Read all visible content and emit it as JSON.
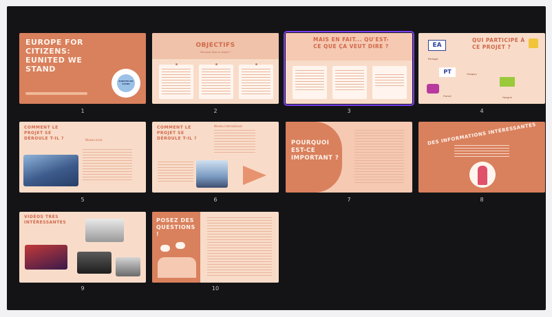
{
  "colors": {
    "frame": "#141417",
    "slide_light": "#f8dcc9",
    "slide_mid": "#f5c9b2",
    "accent": "#d9805d",
    "selected": "#7b3ff2"
  },
  "slides": [
    {
      "number": "1",
      "title": "Europe for citizens: Eunited we stand",
      "badge": "EUNITED WE STAND"
    },
    {
      "number": "2",
      "title": "Objectifs",
      "subtitle": "Pourquoi faire ce projet ?"
    },
    {
      "number": "3",
      "title": "Mais en fait... qu'est-ce que ça veut dire ?"
    },
    {
      "number": "4",
      "title": "Qui participe à ce projet ?",
      "countries": [
        "Portugal",
        "Hungary",
        "France",
        "Hongrie"
      ]
    },
    {
      "number": "5",
      "title": "Comment le projet se déroule t-il ?",
      "tag": "Niveau local"
    },
    {
      "number": "6",
      "title": "Comment le projet se déroule t-il ?",
      "tag": "Niveau international"
    },
    {
      "number": "7",
      "title": "Pourquoi est-ce important ?"
    },
    {
      "number": "8",
      "title": "Des informations intéressantes"
    },
    {
      "number": "9",
      "title": "Vidéos très intéressantes"
    },
    {
      "number": "10",
      "title": "Posez des questions !"
    }
  ]
}
